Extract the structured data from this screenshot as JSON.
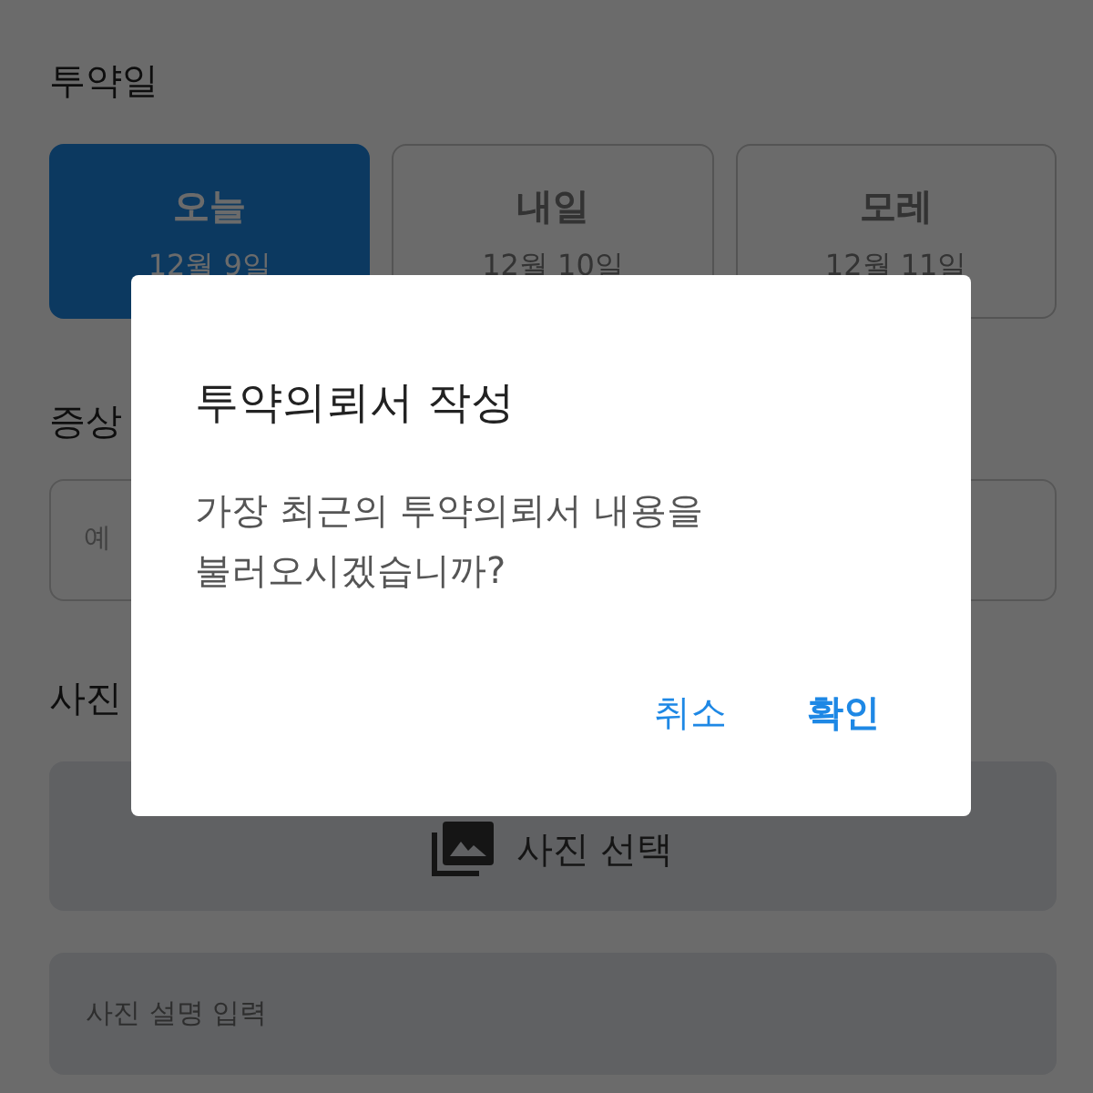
{
  "date_section": {
    "label": "투약일",
    "options": [
      {
        "label": "오늘",
        "date": "12월 9일",
        "selected": true
      },
      {
        "label": "내일",
        "date": "12월 10일",
        "selected": false
      },
      {
        "label": "모레",
        "date": "12월 11일",
        "selected": false
      }
    ]
  },
  "symptom_section": {
    "label": "증상",
    "field": {
      "placeholder": "예"
    }
  },
  "photo_section": {
    "label": "사진",
    "select_button": {
      "label": "사진 선택"
    },
    "description_field": {
      "placeholder": "사진 설명 입력"
    }
  },
  "dialog": {
    "title": "투약의뢰서 작성",
    "message": "가장 최근의 투약의뢰서 내용을\n불러오시겠습니까?",
    "buttons": [
      {
        "label": "취소",
        "kind": "cancel"
      },
      {
        "label": "확인",
        "kind": "confirm"
      }
    ]
  }
}
